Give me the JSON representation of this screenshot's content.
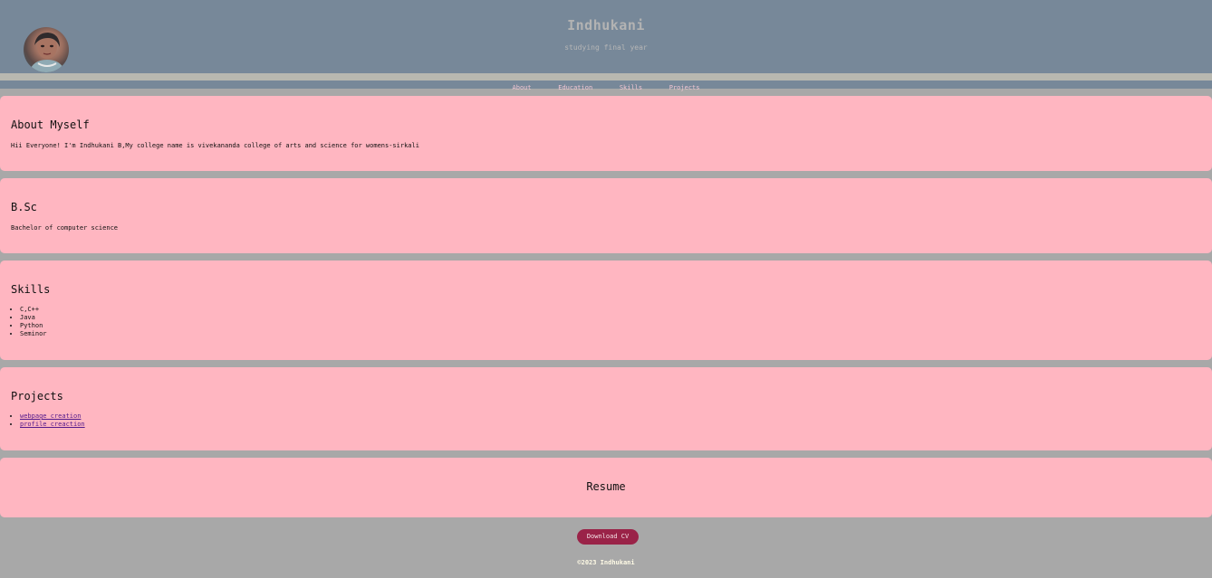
{
  "header": {
    "title": "Indhukani",
    "subtitle": "studying final year"
  },
  "nav": {
    "items": [
      {
        "label": "About"
      },
      {
        "label": "Education"
      },
      {
        "label": "Skills"
      },
      {
        "label": "Projects"
      }
    ]
  },
  "about": {
    "heading": "About Myself",
    "text": "Hii Everyone! I'm Indhukani B,My college name is vivekananda college of arts and science for womens-sirkali"
  },
  "education": {
    "heading": "B.Sc",
    "text": "Bachelor of computer science"
  },
  "skills": {
    "heading": "Skills",
    "items": [
      "C,C++",
      "Java",
      "Python",
      "Seminor"
    ]
  },
  "projects": {
    "heading": "Projects",
    "items": [
      "webpage creation",
      "profile creaction"
    ]
  },
  "resume": {
    "heading": "Resume",
    "button_label": "Download CV"
  },
  "footer": {
    "text": "©2023 Indhukani"
  },
  "colors": {
    "header_bg": "#778899",
    "page_bg": "#a8a8a8",
    "card_bg": "#ffb6c1",
    "button_bg": "#9a2348"
  }
}
